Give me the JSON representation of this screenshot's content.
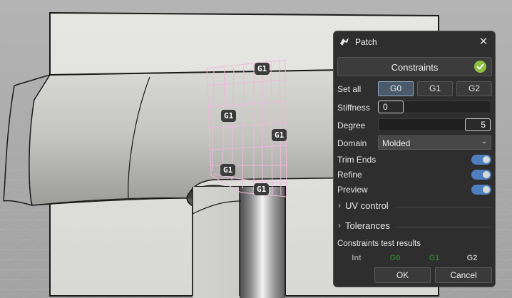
{
  "viewport": {
    "badges": [
      "G1",
      "G1",
      "G1",
      "G1",
      "G1"
    ]
  },
  "dialog": {
    "title": "Patch",
    "title_icon": "grasshopper-icon",
    "close_label": "✕",
    "section": {
      "label": "Constraints",
      "status_icon": "check-icon",
      "status_color": "#8dbe3f"
    },
    "set_all": {
      "label": "Set all",
      "options": [
        "G0",
        "G1",
        "G2"
      ],
      "selected": "G0"
    },
    "stiffness": {
      "label": "Stiffness",
      "value": "0"
    },
    "degree": {
      "label": "Degree",
      "value": "5"
    },
    "domain": {
      "label": "Domain",
      "value": "Molded"
    },
    "toggles": [
      {
        "label": "Trim Ends",
        "on": true
      },
      {
        "label": "Refine",
        "on": true
      },
      {
        "label": "Preview",
        "on": true
      }
    ],
    "expanders": [
      {
        "label": "UV control"
      },
      {
        "label": "Tolerances"
      }
    ],
    "results": {
      "label": "Constraints test results",
      "columns": [
        "Int",
        "G0",
        "G1",
        "G2"
      ],
      "column_colors": [
        "#9a9a9a",
        "#2f7a2f",
        "#2f7a2f",
        "#bdbdbd"
      ]
    },
    "ok_label": "OK",
    "cancel_label": "Cancel",
    "accent": "#4f7fbf"
  }
}
